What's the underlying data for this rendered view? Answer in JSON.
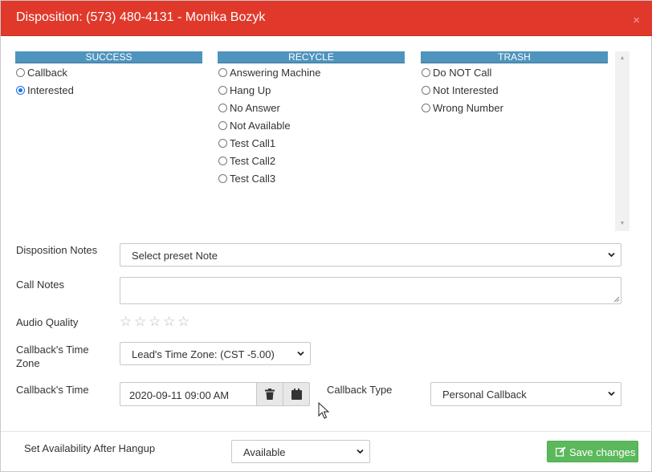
{
  "header": {
    "title": "Disposition: (573) 480-4131 - Monika Bozyk",
    "close_icon": "×"
  },
  "dispositions": {
    "columns": [
      {
        "title": "SUCCESS",
        "options": [
          {
            "label": "Callback",
            "checked": false
          },
          {
            "label": "Interested",
            "checked": true
          }
        ]
      },
      {
        "title": "RECYCLE",
        "options": [
          {
            "label": "Answering Machine",
            "checked": false
          },
          {
            "label": "Hang Up",
            "checked": false
          },
          {
            "label": "No Answer",
            "checked": false
          },
          {
            "label": "Not Available",
            "checked": false
          },
          {
            "label": "Test Call1",
            "checked": false
          },
          {
            "label": "Test Call2",
            "checked": false
          },
          {
            "label": "Test Call3",
            "checked": false
          }
        ]
      },
      {
        "title": "TRASH",
        "options": [
          {
            "label": "Do NOT Call",
            "checked": false
          },
          {
            "label": "Not Interested",
            "checked": false
          },
          {
            "label": "Wrong Number",
            "checked": false
          }
        ]
      }
    ]
  },
  "form": {
    "disposition_notes_label": "Disposition Notes",
    "disposition_notes_value": "Select preset Note",
    "call_notes_label": "Call Notes",
    "call_notes_value": "",
    "audio_quality_label": "Audio Quality",
    "audio_quality_rating": 0,
    "audio_quality_max": 5,
    "callback_timezone_label_line1": "Callback's Time",
    "callback_timezone_label_line2": "Zone",
    "callback_timezone_value": "Lead's Time Zone: (CST -5.00)",
    "callback_time_label": "Callback's Time",
    "callback_time_value": "2020-09-11 09:00 AM",
    "callback_type_label": "Callback Type",
    "callback_type_value": "Personal Callback"
  },
  "footer": {
    "availability_label": "Set Availability After Hangup",
    "availability_value": "Available",
    "save_label": "Save changes"
  },
  "colors": {
    "header_bg": "#e0392b",
    "column_header_bg": "#4f94bd",
    "save_button_bg": "#5cb85c",
    "radio_checked": "#1a73e8"
  }
}
